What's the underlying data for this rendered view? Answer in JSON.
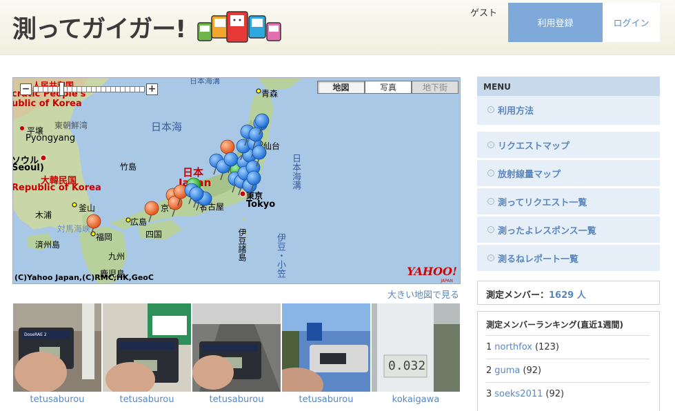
{
  "header": {
    "logo_text": "測ってガイガー!",
    "guest_label": "ゲスト",
    "register_label": "利用登録",
    "login_label": "ログイン"
  },
  "map": {
    "zoom_out": "−",
    "zoom_in": "+",
    "types": [
      "地図",
      "写真",
      "地下街"
    ],
    "labels": {
      "dprk": "人民共和国",
      "dprk_en": "cratic People's",
      "dprk_en2": "ublic of Korea",
      "tohoku_sea": "東朝鮮湾",
      "pyongyang": "平壌",
      "pyongyang_en": "Pyongyang",
      "seoul": "ソウル",
      "seoul_en": "Seoul)",
      "rok": "大韓民国",
      "rok_en": "Republic of Korea",
      "mokpo": "木浦",
      "busan": "釜山",
      "jeju": "済州島",
      "tsushima": "対馬海峡",
      "sea_of_japan": "日本海",
      "sea_of_japan_en": "日本海",
      "takeshima": "竹島",
      "aomori": "青森",
      "sendai": "仙台",
      "japan": "日本",
      "japan_en": "Japan",
      "tokyo": "東京",
      "tokyo_en": "Tokyo",
      "nagoya": "名古屋",
      "kyoto": "京",
      "hiroshima": "広島",
      "fukuoka": "福岡",
      "shikoku": "四国",
      "kyushu": "九州",
      "kagoshima": "鹿児島",
      "izu": "伊豆諸島",
      "izu_ogasawara": "伊豆・小笠",
      "japan_trench": "日本海溝",
      "japan_top": "日本海溝"
    },
    "copyright": "(C)Yahoo Japan,(C)RMC,HK,GeoC",
    "yahoo_logo": "YAHOO!",
    "yahoo_sub": "JAPAN",
    "big_map_link": "大きい地図で見る"
  },
  "photos": [
    {
      "user": "tetusaburou"
    },
    {
      "user": "tetusaburou"
    },
    {
      "user": "tetusaburou"
    },
    {
      "user": "tetusaburou"
    },
    {
      "user": "kokaigawa"
    }
  ],
  "photo_texts": {
    "device_brand": "DoseRAE 2",
    "reading_1": "0.08",
    "reading_5": "0.032"
  },
  "sidebar": {
    "menu_title": "MENU",
    "menu_items": [
      "利用方法",
      "リクエストマップ",
      "放射線量マップ",
      "測ってリクエスト一覧",
      "測ったよレスポンス一覧",
      "測るねレポート一覧"
    ],
    "member_label": "測定メンバー：",
    "member_count": "1629",
    "member_unit": "人",
    "ranking_title": "測定メンバーランキング(直近1週間)",
    "ranking": [
      {
        "rank": "1",
        "name": "northfox",
        "count": "(123)"
      },
      {
        "rank": "2",
        "name": "guma",
        "count": "(92)"
      },
      {
        "rank": "3",
        "name": "soeks2011",
        "count": "(92)"
      }
    ]
  },
  "colors": {
    "accent_blue": "#7fa9d8",
    "link_blue": "#5a87c0",
    "menu_bg": "#e6eef7",
    "pin_blue": "#3d8ef0",
    "pin_orange": "#f07a3c",
    "pin_green": "#3fbf3f"
  }
}
